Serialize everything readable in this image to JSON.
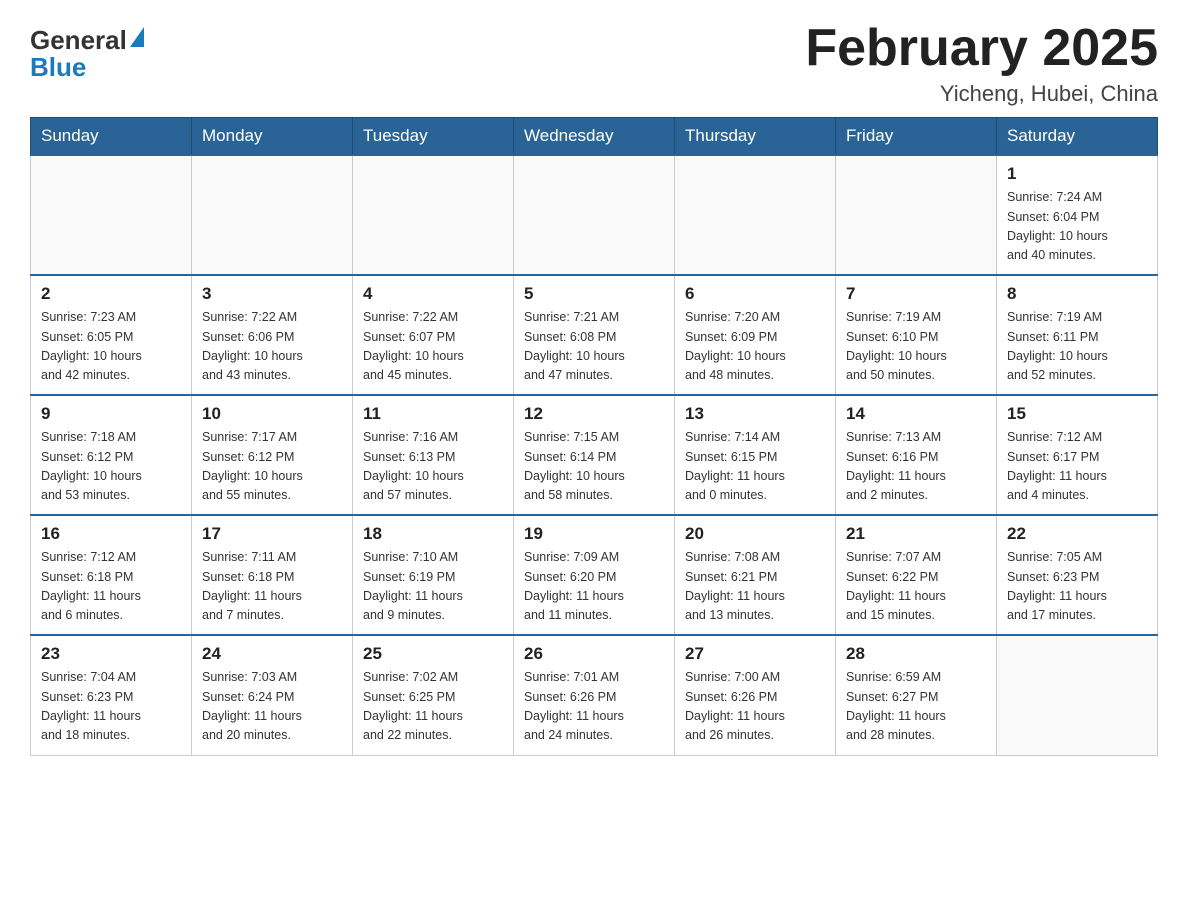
{
  "header": {
    "logo_general": "General",
    "logo_blue": "Blue",
    "title": "February 2025",
    "subtitle": "Yicheng, Hubei, China"
  },
  "weekdays": [
    "Sunday",
    "Monday",
    "Tuesday",
    "Wednesday",
    "Thursday",
    "Friday",
    "Saturday"
  ],
  "weeks": [
    [
      {
        "day": "",
        "info": ""
      },
      {
        "day": "",
        "info": ""
      },
      {
        "day": "",
        "info": ""
      },
      {
        "day": "",
        "info": ""
      },
      {
        "day": "",
        "info": ""
      },
      {
        "day": "",
        "info": ""
      },
      {
        "day": "1",
        "info": "Sunrise: 7:24 AM\nSunset: 6:04 PM\nDaylight: 10 hours\nand 40 minutes."
      }
    ],
    [
      {
        "day": "2",
        "info": "Sunrise: 7:23 AM\nSunset: 6:05 PM\nDaylight: 10 hours\nand 42 minutes."
      },
      {
        "day": "3",
        "info": "Sunrise: 7:22 AM\nSunset: 6:06 PM\nDaylight: 10 hours\nand 43 minutes."
      },
      {
        "day": "4",
        "info": "Sunrise: 7:22 AM\nSunset: 6:07 PM\nDaylight: 10 hours\nand 45 minutes."
      },
      {
        "day": "5",
        "info": "Sunrise: 7:21 AM\nSunset: 6:08 PM\nDaylight: 10 hours\nand 47 minutes."
      },
      {
        "day": "6",
        "info": "Sunrise: 7:20 AM\nSunset: 6:09 PM\nDaylight: 10 hours\nand 48 minutes."
      },
      {
        "day": "7",
        "info": "Sunrise: 7:19 AM\nSunset: 6:10 PM\nDaylight: 10 hours\nand 50 minutes."
      },
      {
        "day": "8",
        "info": "Sunrise: 7:19 AM\nSunset: 6:11 PM\nDaylight: 10 hours\nand 52 minutes."
      }
    ],
    [
      {
        "day": "9",
        "info": "Sunrise: 7:18 AM\nSunset: 6:12 PM\nDaylight: 10 hours\nand 53 minutes."
      },
      {
        "day": "10",
        "info": "Sunrise: 7:17 AM\nSunset: 6:12 PM\nDaylight: 10 hours\nand 55 minutes."
      },
      {
        "day": "11",
        "info": "Sunrise: 7:16 AM\nSunset: 6:13 PM\nDaylight: 10 hours\nand 57 minutes."
      },
      {
        "day": "12",
        "info": "Sunrise: 7:15 AM\nSunset: 6:14 PM\nDaylight: 10 hours\nand 58 minutes."
      },
      {
        "day": "13",
        "info": "Sunrise: 7:14 AM\nSunset: 6:15 PM\nDaylight: 11 hours\nand 0 minutes."
      },
      {
        "day": "14",
        "info": "Sunrise: 7:13 AM\nSunset: 6:16 PM\nDaylight: 11 hours\nand 2 minutes."
      },
      {
        "day": "15",
        "info": "Sunrise: 7:12 AM\nSunset: 6:17 PM\nDaylight: 11 hours\nand 4 minutes."
      }
    ],
    [
      {
        "day": "16",
        "info": "Sunrise: 7:12 AM\nSunset: 6:18 PM\nDaylight: 11 hours\nand 6 minutes."
      },
      {
        "day": "17",
        "info": "Sunrise: 7:11 AM\nSunset: 6:18 PM\nDaylight: 11 hours\nand 7 minutes."
      },
      {
        "day": "18",
        "info": "Sunrise: 7:10 AM\nSunset: 6:19 PM\nDaylight: 11 hours\nand 9 minutes."
      },
      {
        "day": "19",
        "info": "Sunrise: 7:09 AM\nSunset: 6:20 PM\nDaylight: 11 hours\nand 11 minutes."
      },
      {
        "day": "20",
        "info": "Sunrise: 7:08 AM\nSunset: 6:21 PM\nDaylight: 11 hours\nand 13 minutes."
      },
      {
        "day": "21",
        "info": "Sunrise: 7:07 AM\nSunset: 6:22 PM\nDaylight: 11 hours\nand 15 minutes."
      },
      {
        "day": "22",
        "info": "Sunrise: 7:05 AM\nSunset: 6:23 PM\nDaylight: 11 hours\nand 17 minutes."
      }
    ],
    [
      {
        "day": "23",
        "info": "Sunrise: 7:04 AM\nSunset: 6:23 PM\nDaylight: 11 hours\nand 18 minutes."
      },
      {
        "day": "24",
        "info": "Sunrise: 7:03 AM\nSunset: 6:24 PM\nDaylight: 11 hours\nand 20 minutes."
      },
      {
        "day": "25",
        "info": "Sunrise: 7:02 AM\nSunset: 6:25 PM\nDaylight: 11 hours\nand 22 minutes."
      },
      {
        "day": "26",
        "info": "Sunrise: 7:01 AM\nSunset: 6:26 PM\nDaylight: 11 hours\nand 24 minutes."
      },
      {
        "day": "27",
        "info": "Sunrise: 7:00 AM\nSunset: 6:26 PM\nDaylight: 11 hours\nand 26 minutes."
      },
      {
        "day": "28",
        "info": "Sunrise: 6:59 AM\nSunset: 6:27 PM\nDaylight: 11 hours\nand 28 minutes."
      },
      {
        "day": "",
        "info": ""
      }
    ]
  ]
}
